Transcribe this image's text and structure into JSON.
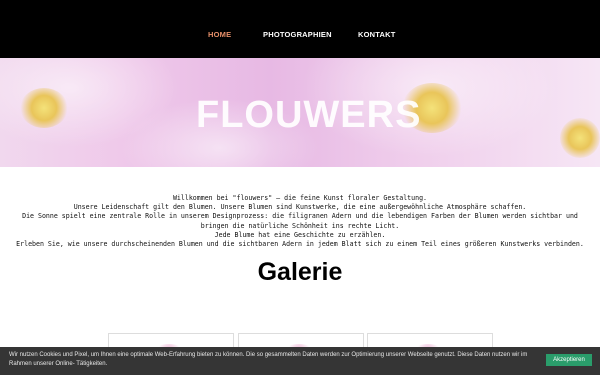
{
  "nav": {
    "items": [
      {
        "label": "HOME",
        "active": true
      },
      {
        "label": "PHOTOGRAPHIEN",
        "active": false
      },
      {
        "label": "KONTAKT",
        "active": false
      }
    ]
  },
  "hero": {
    "title": "FLOUWERS"
  },
  "intro": {
    "lines": [
      "Willkommen bei \"flouwers\" – die feine Kunst floraler Gestaltung.",
      "Unsere Leidenschaft gilt den Blumen. Unsere Blumen sind Kunstwerke, die eine außergewöhnliche Atmosphäre schaffen.",
      "Die Sonne spielt eine zentrale Rolle in unserem Designprozess: die filigranen Adern und die lebendigen Farben der Blumen werden sichtbar und",
      "bringen die natürliche Schönheit ins rechte Licht.",
      "Jede Blume hat eine Geschichte zu erzählen.",
      "Erleben Sie, wie unsere durchscheinenden Blumen und die sichtbaren Adern in jedem Blatt sich zu einem Teil eines größeren Kunstwerks verbinden."
    ]
  },
  "gallery": {
    "heading": "Galerie"
  },
  "cookie_banner": {
    "text": "Wir nutzen Cookies und Pixel, um Ihnen eine optimale Web-Erfahrung bieten zu können. Die so gesammelten Daten werden zur Optimierung unserer Webseite genutzt. Diese Daten nutzen wir im Rahmen unserer Online- Tätigkeiten.",
    "accept_label": "Akzeptieren"
  },
  "colors": {
    "nav_background": "#000000",
    "nav_active": "#e8906a",
    "accept_button": "#2a9d6b",
    "banner_background": "#353535"
  }
}
